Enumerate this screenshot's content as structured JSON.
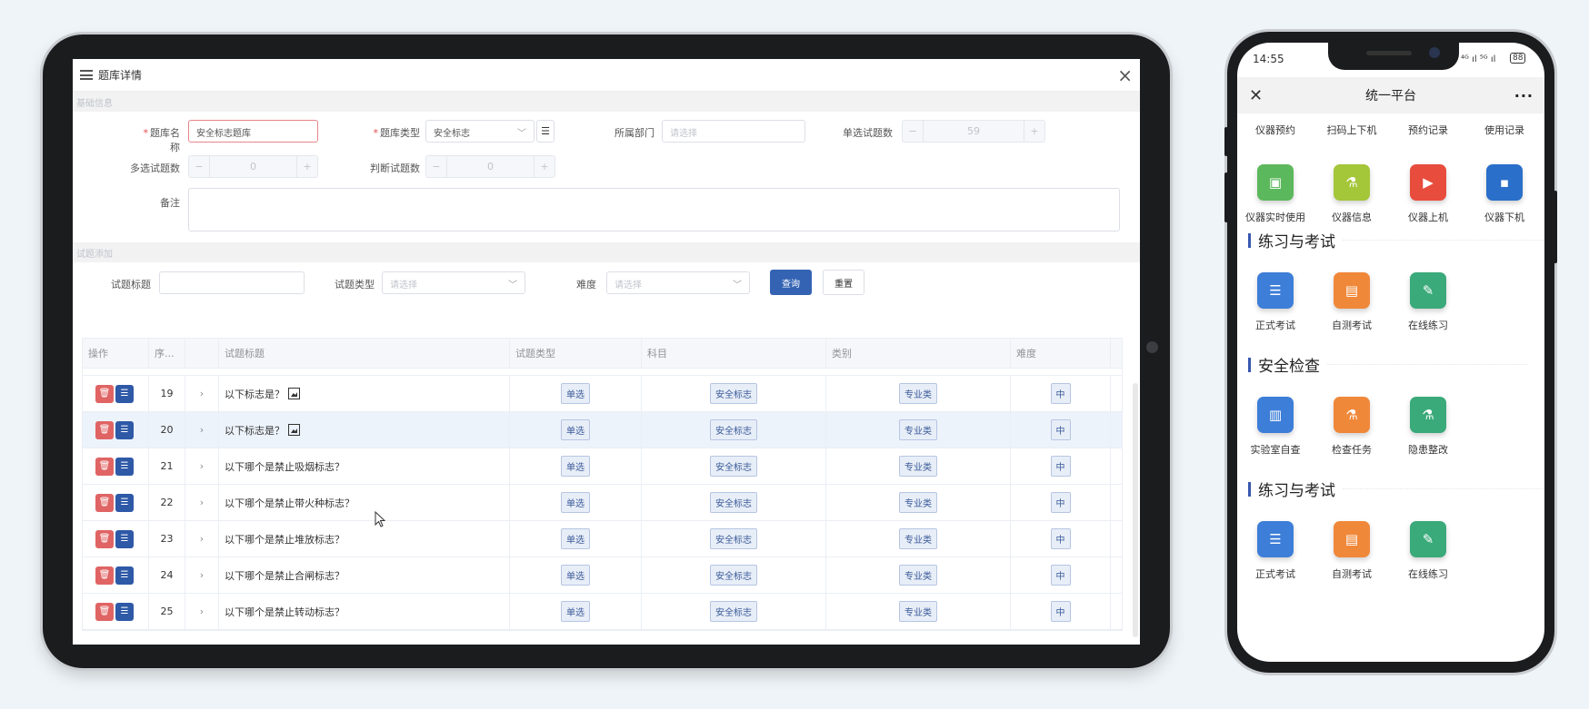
{
  "tablet": {
    "window_title": "题库详情",
    "section_basic": "基础信息",
    "section_questions": "试题添加",
    "form": {
      "bank_name_label": "题库名称",
      "bank_name_value": "安全标志题库",
      "bank_type_label": "题库类型",
      "bank_type_value": "安全标志",
      "dept_label": "所属部门",
      "dept_placeholder": "请选择",
      "single_count_label": "单选试题数",
      "single_count_value": "59",
      "multi_count_label": "多选试题数",
      "multi_count_value": "0",
      "judge_count_label": "判断试题数",
      "judge_count_value": "0",
      "remark_label": "备注",
      "minus": "−",
      "plus": "+"
    },
    "filter": {
      "title_label": "试题标题",
      "type_label": "试题类型",
      "type_placeholder": "请选择",
      "difficulty_label": "难度",
      "difficulty_placeholder": "请选择",
      "query_button": "查询",
      "reset_button": "重置"
    },
    "table": {
      "headers": [
        "操作",
        "序...",
        "",
        "试题标题",
        "试题类型",
        "科目",
        "类别",
        "难度"
      ],
      "rows": [
        {
          "seq": "19",
          "title": "以下标志是？",
          "type": "单选",
          "subject": "安全标志",
          "category": "专业类",
          "difficulty": "中",
          "has_image": true
        },
        {
          "seq": "20",
          "title": "以下标志是？",
          "type": "单选",
          "subject": "安全标志",
          "category": "专业类",
          "difficulty": "中",
          "has_image": true
        },
        {
          "seq": "21",
          "title": "以下哪个是禁止吸烟标志？",
          "type": "单选",
          "subject": "安全标志",
          "category": "专业类",
          "difficulty": "中",
          "has_image": false
        },
        {
          "seq": "22",
          "title": "以下哪个是禁止带火种标志？",
          "type": "单选",
          "subject": "安全标志",
          "category": "专业类",
          "difficulty": "中",
          "has_image": false
        },
        {
          "seq": "23",
          "title": "以下哪个是禁止堆放标志？",
          "type": "单选",
          "subject": "安全标志",
          "category": "专业类",
          "difficulty": "中",
          "has_image": false
        },
        {
          "seq": "24",
          "title": "以下哪个是禁止合闸标志？",
          "type": "单选",
          "subject": "安全标志",
          "category": "专业类",
          "difficulty": "中",
          "has_image": false
        },
        {
          "seq": "25",
          "title": "以下哪个是禁止转动标志？",
          "type": "单选",
          "subject": "安全标志",
          "category": "专业类",
          "difficulty": "中",
          "has_image": false
        }
      ],
      "expand_glyph": "›"
    }
  },
  "phone": {
    "time": "14:55",
    "signal": "⁴ᴳ ıl ⁵ᴳ ıl",
    "battery": "88",
    "nav_title": "统一平台",
    "close_glyph": "✕",
    "more_glyph": "···",
    "row1": [
      {
        "label": "仪器预约"
      },
      {
        "label": "扫码上下机"
      },
      {
        "label": "预约记录"
      },
      {
        "label": "使用记录"
      }
    ],
    "row2": [
      {
        "label": "仪器实时使用",
        "color": "#5cb85c",
        "glyph": "▣"
      },
      {
        "label": "仪器信息",
        "color": "#a4c639",
        "glyph": "⚗"
      },
      {
        "label": "仪器上机",
        "color": "#e74c3c",
        "glyph": "▶"
      },
      {
        "label": "仪器下机",
        "color": "#2a6fc9",
        "glyph": "▪"
      }
    ],
    "section1_title": "练习与考试",
    "row3": [
      {
        "label": "正式考试",
        "color": "#3d7ed8",
        "glyph": "☰"
      },
      {
        "label": "自测考试",
        "color": "#f0883a",
        "glyph": "▤"
      },
      {
        "label": "在线练习",
        "color": "#3aaa7a",
        "glyph": "✎"
      }
    ],
    "section2_title": "安全检查",
    "row4": [
      {
        "label": "实验室自查",
        "color": "#3d7ed8",
        "glyph": "▥"
      },
      {
        "label": "检查任务",
        "color": "#f0883a",
        "glyph": "⚗"
      },
      {
        "label": "隐患整改",
        "color": "#3aaa7a",
        "glyph": "⚗"
      }
    ],
    "section3_title": "练习与考试",
    "row5": [
      {
        "label": "正式考试",
        "color": "#3d7ed8",
        "glyph": "☰"
      },
      {
        "label": "自测考试",
        "color": "#f0883a",
        "glyph": "▤"
      },
      {
        "label": "在线练习",
        "color": "#3aaa7a",
        "glyph": "✎"
      }
    ]
  }
}
